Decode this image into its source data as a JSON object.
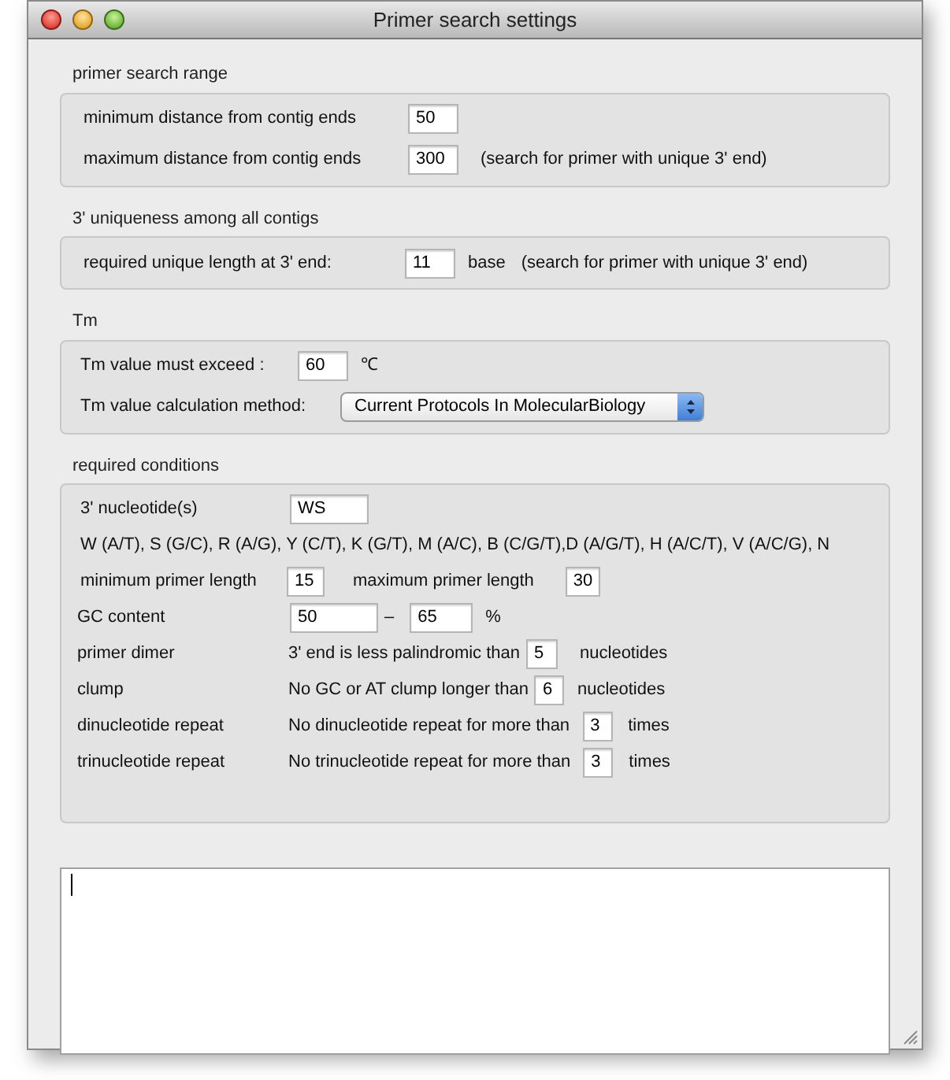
{
  "window": {
    "title": "Primer search settings"
  },
  "sections": [
    {
      "title": "primer search range",
      "rows": [
        {
          "items": [
            {
              "kind": "text",
              "text": "minimum distance from contig ends"
            },
            {
              "kind": "input",
              "value": "50"
            }
          ]
        },
        {
          "items": [
            {
              "kind": "text",
              "text": "maximum distance from contig ends"
            },
            {
              "kind": "input",
              "value": "300"
            },
            {
              "kind": "text",
              "text": "(search for primer with unique 3' end)"
            }
          ]
        }
      ]
    },
    {
      "title": "3' uniqueness among all contigs",
      "rows": [
        {
          "items": [
            {
              "kind": "text",
              "text": "required unique length at 3' end:"
            },
            {
              "kind": "input",
              "value": "11"
            },
            {
              "kind": "text",
              "text": "base"
            },
            {
              "kind": "text",
              "text": "(search for primer with unique 3' end)"
            }
          ]
        }
      ]
    },
    {
      "title": "Tm",
      "rows": [
        {
          "items": [
            {
              "kind": "text",
              "text": "Tm value must exceed :"
            },
            {
              "kind": "input",
              "value": "60"
            },
            {
              "kind": "text",
              "text": "℃"
            }
          ]
        },
        {
          "items": [
            {
              "kind": "text",
              "text": "Tm value calculation method:"
            },
            {
              "kind": "select",
              "value": "Current Protocols In MolecularBiology"
            }
          ]
        }
      ]
    },
    {
      "title": "required conditions",
      "rows": [
        {
          "items": [
            {
              "kind": "text",
              "text": "3' nucleotide(s)"
            },
            {
              "kind": "input",
              "value": "WS"
            }
          ]
        },
        {
          "items": [
            {
              "kind": "text",
              "text": "W (A/T), S (G/C), R (A/G), Y (C/T), K (G/T), M (A/C), B (C/G/T),D (A/G/T), H (A/C/T), V (A/C/G), N"
            }
          ]
        },
        {
          "items": [
            {
              "kind": "text",
              "text": "minimum primer length"
            },
            {
              "kind": "input",
              "value": "15"
            },
            {
              "kind": "text",
              "text": "maximum primer length"
            },
            {
              "kind": "input",
              "value": "30"
            }
          ]
        },
        {
          "items": [
            {
              "kind": "text",
              "text": "GC content"
            },
            {
              "kind": "input",
              "value": "50"
            },
            {
              "kind": "text",
              "text": "–"
            },
            {
              "kind": "input",
              "value": "65"
            },
            {
              "kind": "text",
              "text": "%"
            }
          ]
        },
        {
          "items": [
            {
              "kind": "text",
              "text": "primer dimer"
            },
            {
              "kind": "text",
              "text": "3' end is less palindromic than"
            },
            {
              "kind": "input",
              "value": "5"
            },
            {
              "kind": "text",
              "text": "nucleotides"
            }
          ]
        },
        {
          "items": [
            {
              "kind": "text",
              "text": "clump"
            },
            {
              "kind": "text",
              "text": "No GC or AT clump longer than"
            },
            {
              "kind": "input",
              "value": "6"
            },
            {
              "kind": "text",
              "text": "nucleotides"
            }
          ]
        },
        {
          "items": [
            {
              "kind": "text",
              "text": "dinucleotide repeat"
            },
            {
              "kind": "text",
              "text": "No dinucleotide repeat for more than"
            },
            {
              "kind": "input",
              "value": "3"
            },
            {
              "kind": "text",
              "text": "times"
            }
          ]
        },
        {
          "items": [
            {
              "kind": "text",
              "text": "trinucleotide repeat"
            },
            {
              "kind": "text",
              "text": "No trinucleotide repeat for more than"
            },
            {
              "kind": "input",
              "value": "3"
            },
            {
              "kind": "text",
              "text": "times"
            }
          ]
        }
      ]
    }
  ],
  "log": {
    "kind": "text-area"
  }
}
